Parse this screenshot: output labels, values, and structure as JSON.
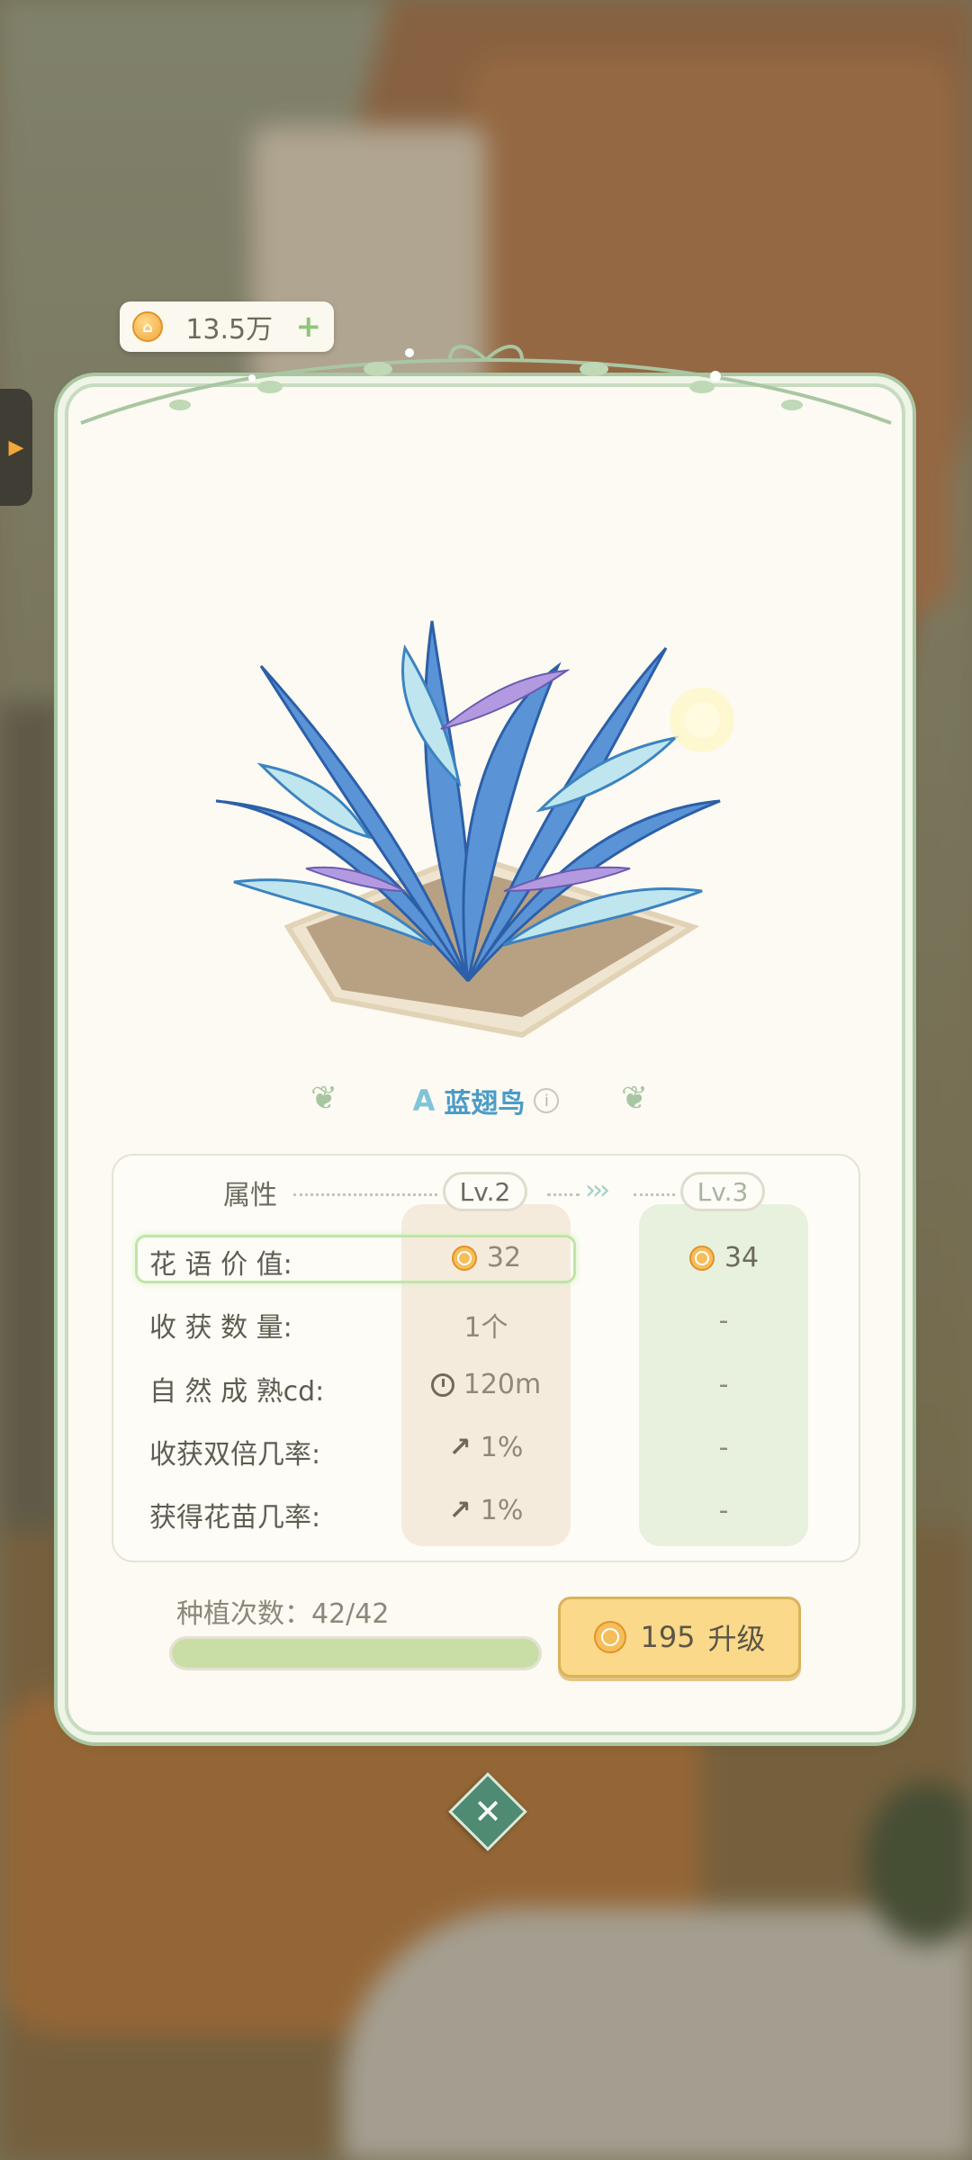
{
  "currency": {
    "amount": "13.5万",
    "plus": "+"
  },
  "plant": {
    "rarity_mark": "A",
    "name": "蓝翅鸟",
    "info": "i"
  },
  "stats": {
    "header": "属性",
    "current_level": "Lv.2",
    "next_level": "Lv.3",
    "rows": [
      {
        "label": "花 语 价 值:",
        "current": "32",
        "next": "34",
        "icon": "coin-icon"
      },
      {
        "label": "收 获 数 量:",
        "current": "1个",
        "next": "-",
        "icon": ""
      },
      {
        "label": "自 然 成 熟cd:",
        "current": "120m",
        "next": "-",
        "icon": "clock-icon"
      },
      {
        "label": "收获双倍几率:",
        "current": "1%",
        "next": "-",
        "icon": "arrow-up-right-icon"
      },
      {
        "label": "获得花苗几率:",
        "current": "1%",
        "next": "-",
        "icon": "arrow-up-right-icon"
      }
    ]
  },
  "planting": {
    "label": "种植次数：42/42",
    "progress": 1.0
  },
  "upgrade": {
    "cost": "195",
    "label": "升级"
  },
  "colors": {
    "panel_bg": "#fcfaf2",
    "accent_green": "#a9c6a2",
    "upgrade_btn": "#fbd98a",
    "coin": "#f1a83b"
  }
}
